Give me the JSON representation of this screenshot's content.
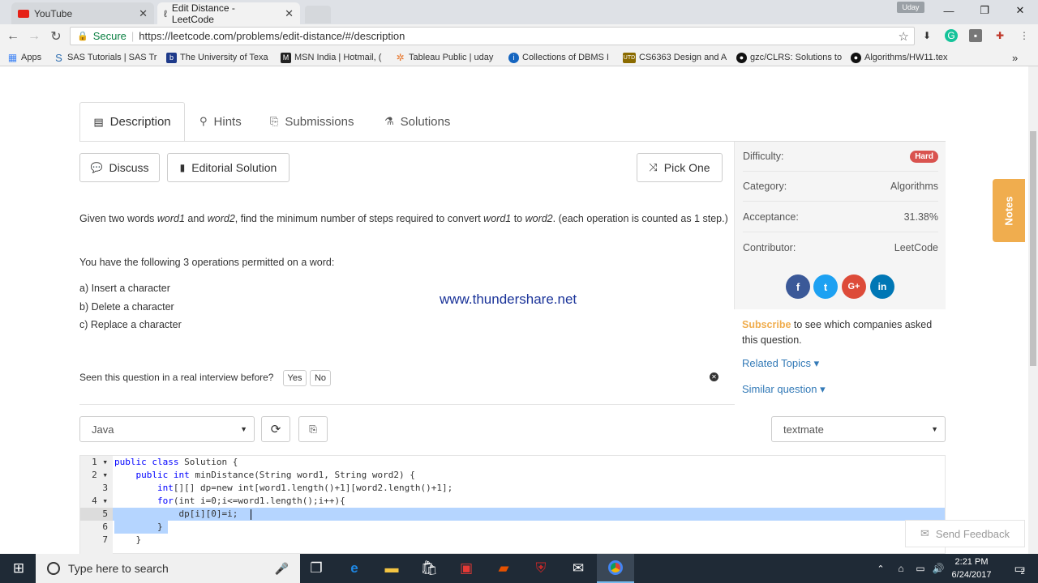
{
  "browser": {
    "tabs": [
      {
        "title": "YouTube",
        "icon": "youtube-icon"
      },
      {
        "title": "Edit Distance - LeetCode",
        "icon": "leetcode-icon"
      }
    ],
    "user_badge": "Uday",
    "secure_label": "Secure",
    "url": "https://leetcode.com/problems/edit-distance/#/description",
    "bookmarks": [
      {
        "label": "Apps",
        "icon": "apps-grid-icon",
        "color": "#4285f4"
      },
      {
        "label": "SAS Tutorials | SAS Tr",
        "icon": "sas-icon",
        "color": "#2b6cb0"
      },
      {
        "label": "The University of Texa",
        "icon": "bookmark-b-icon",
        "color": "#1e3a8a"
      },
      {
        "label": "MSN India | Hotmail, (",
        "icon": "msn-icon",
        "color": "#222222"
      },
      {
        "label": "Tableau Public | uday",
        "icon": "tableau-icon",
        "color": "#e8762b"
      },
      {
        "label": "Collections of DBMS I",
        "icon": "info-icon",
        "color": "#1565c0"
      },
      {
        "label": "CS6363 Design and A",
        "icon": "utd-icon",
        "color": "#8b6b00"
      },
      {
        "label": "gzc/CLRS: Solutions to",
        "icon": "github-icon",
        "color": "#111111"
      },
      {
        "label": "Algorithms/HW11.tex",
        "icon": "github-icon",
        "color": "#111111"
      }
    ],
    "more_bookmarks": "»"
  },
  "page": {
    "tabs": [
      {
        "label": "Description",
        "icon": "description-icon",
        "active": true
      },
      {
        "label": "Hints",
        "icon": "lightbulb-icon"
      },
      {
        "label": "Submissions",
        "icon": "submissions-icon"
      },
      {
        "label": "Solutions",
        "icon": "flask-icon"
      }
    ],
    "buttons": {
      "discuss": "Discuss",
      "editorial": "Editorial Solution",
      "pick_one": "Pick One"
    },
    "description": {
      "p1_a": "Given two words ",
      "word1": "word1",
      "p1_b": " and ",
      "word2": "word2",
      "p1_c": ", find the minimum number of steps required to convert ",
      "p1_d": " to ",
      "p1_e": ". (each operation is counted as 1 step.)",
      "p2": "You have the following 3 operations permitted on a word:",
      "ops": [
        "a) Insert a character",
        "b) Delete a character",
        "c) Replace a character"
      ]
    },
    "watermark": "www.thundershare.net",
    "interview": {
      "question": "Seen this question in a real interview before?",
      "yes": "Yes",
      "no": "No"
    },
    "sidebar": {
      "difficulty_label": "Difficulty:",
      "difficulty_value": "Hard",
      "category_label": "Category:",
      "category_value": "Algorithms",
      "acceptance_label": "Acceptance:",
      "acceptance_value": "31.38%",
      "contributor_label": "Contributor:",
      "contributor_value": "LeetCode",
      "social": [
        {
          "label": "f",
          "color": "#3b5998"
        },
        {
          "label": "t",
          "color": "#1da1f2"
        },
        {
          "label": "G+",
          "color": "#dd4b39"
        },
        {
          "label": "in",
          "color": "#0077b5"
        }
      ],
      "subscribe_link": "Subscribe",
      "subscribe_text": " to see which companies asked this question.",
      "related_topics": "Related Topics ▾",
      "similar_question": "Similar question ▾"
    },
    "notes_label": "Notes",
    "language_select": "Java",
    "theme_select": "textmate",
    "editor": {
      "lines": [
        {
          "n": "1 ▾",
          "kw": "public class",
          "rest": " Solution {"
        },
        {
          "n": "2 ▾",
          "kw": "    public int",
          "rest": " minDistance(String word1, String word2) {"
        },
        {
          "n": "3",
          "kw": "        int",
          "rest": "[][] dp=new int[word1.length()+1][word2.length()+1];"
        },
        {
          "n": "4 ▾",
          "kw": "        for",
          "rest": "(int i=0;i<=word1.length();i++){"
        },
        {
          "n": "5",
          "kw": "",
          "rest": "            dp[i][0]=i;"
        },
        {
          "n": "6",
          "kw": "",
          "rest": "        }"
        },
        {
          "n": "7",
          "kw": "",
          "rest": "    }"
        }
      ]
    },
    "send_feedback": "Send Feedback"
  },
  "taskbar": {
    "search_placeholder": "Type here to search",
    "time": "2:21 PM",
    "date": "6/24/2017",
    "notification_count": "2"
  }
}
